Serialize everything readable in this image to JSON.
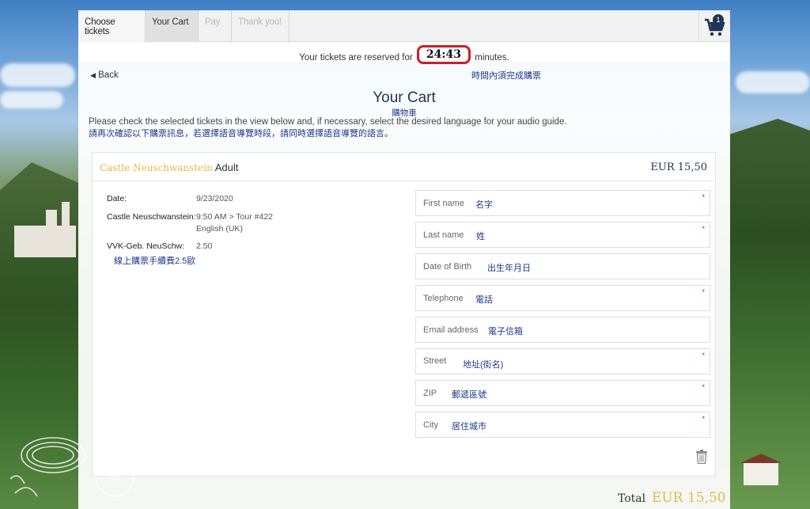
{
  "steps": [
    {
      "label": "Choose tickets",
      "state": "done"
    },
    {
      "label": "Your Cart",
      "state": "active"
    },
    {
      "label": "Pay",
      "state": "todo"
    },
    {
      "label": "Thank you!",
      "state": "todo"
    }
  ],
  "cart": {
    "count": "1",
    "icon": "cart-icon"
  },
  "reservation": {
    "prefix": "Your tickets are reserved for",
    "time": "24:43",
    "suffix": "minutes."
  },
  "nav": {
    "back": "Back",
    "note_cn": "時間內須完成購票"
  },
  "header": {
    "title": "Your Cart",
    "title_cn": "購物車",
    "intro": "Please check the selected tickets in the view below and, if necessary, select the desired language for your audio guide.",
    "intro_cn": "請再次確認以下購票訊息，若選擇語音導覽時段，請同時選擇語音導覽的語言。"
  },
  "ticket": {
    "place": "Castle Neuschwanstein",
    "type": "Adult",
    "price": "EUR 15,50",
    "date_label": "Date:",
    "date_value": "9/23/2020",
    "castle_label": "Castle Neuschwanstein:",
    "castle_value": "9:50 AM > Tour #422",
    "language": "English (UK)",
    "fee_label": "VVK-Geb. NeuSchw:",
    "fee_value": "2.50",
    "fee_note_cn": "線上購票手續費2.5歐"
  },
  "form": [
    {
      "label": "First name",
      "hint_cn": "名字",
      "required": "*"
    },
    {
      "label": "Last name",
      "hint_cn": "姓",
      "required": "*"
    },
    {
      "label": "Date of Birth",
      "hint_cn": "出生年月日",
      "required": ""
    },
    {
      "label": "Telephone",
      "hint_cn": "電話",
      "required": "*"
    },
    {
      "label": "Email address",
      "hint_cn": "電子信箱",
      "required": ""
    },
    {
      "label": "Street",
      "hint_cn": "地址(街名)",
      "required": "*"
    },
    {
      "label": "ZIP",
      "hint_cn": "郵遞區號",
      "required": "*"
    },
    {
      "label": "City",
      "hint_cn": "居住城市",
      "required": "*"
    }
  ],
  "total": {
    "label": "Total",
    "value": "EUR 15,50"
  },
  "colors": {
    "accent_gold": "#e8b84a",
    "navy": "#1e3556",
    "timer_border": "#c8202a",
    "chinese_note": "#1f3a8a"
  }
}
